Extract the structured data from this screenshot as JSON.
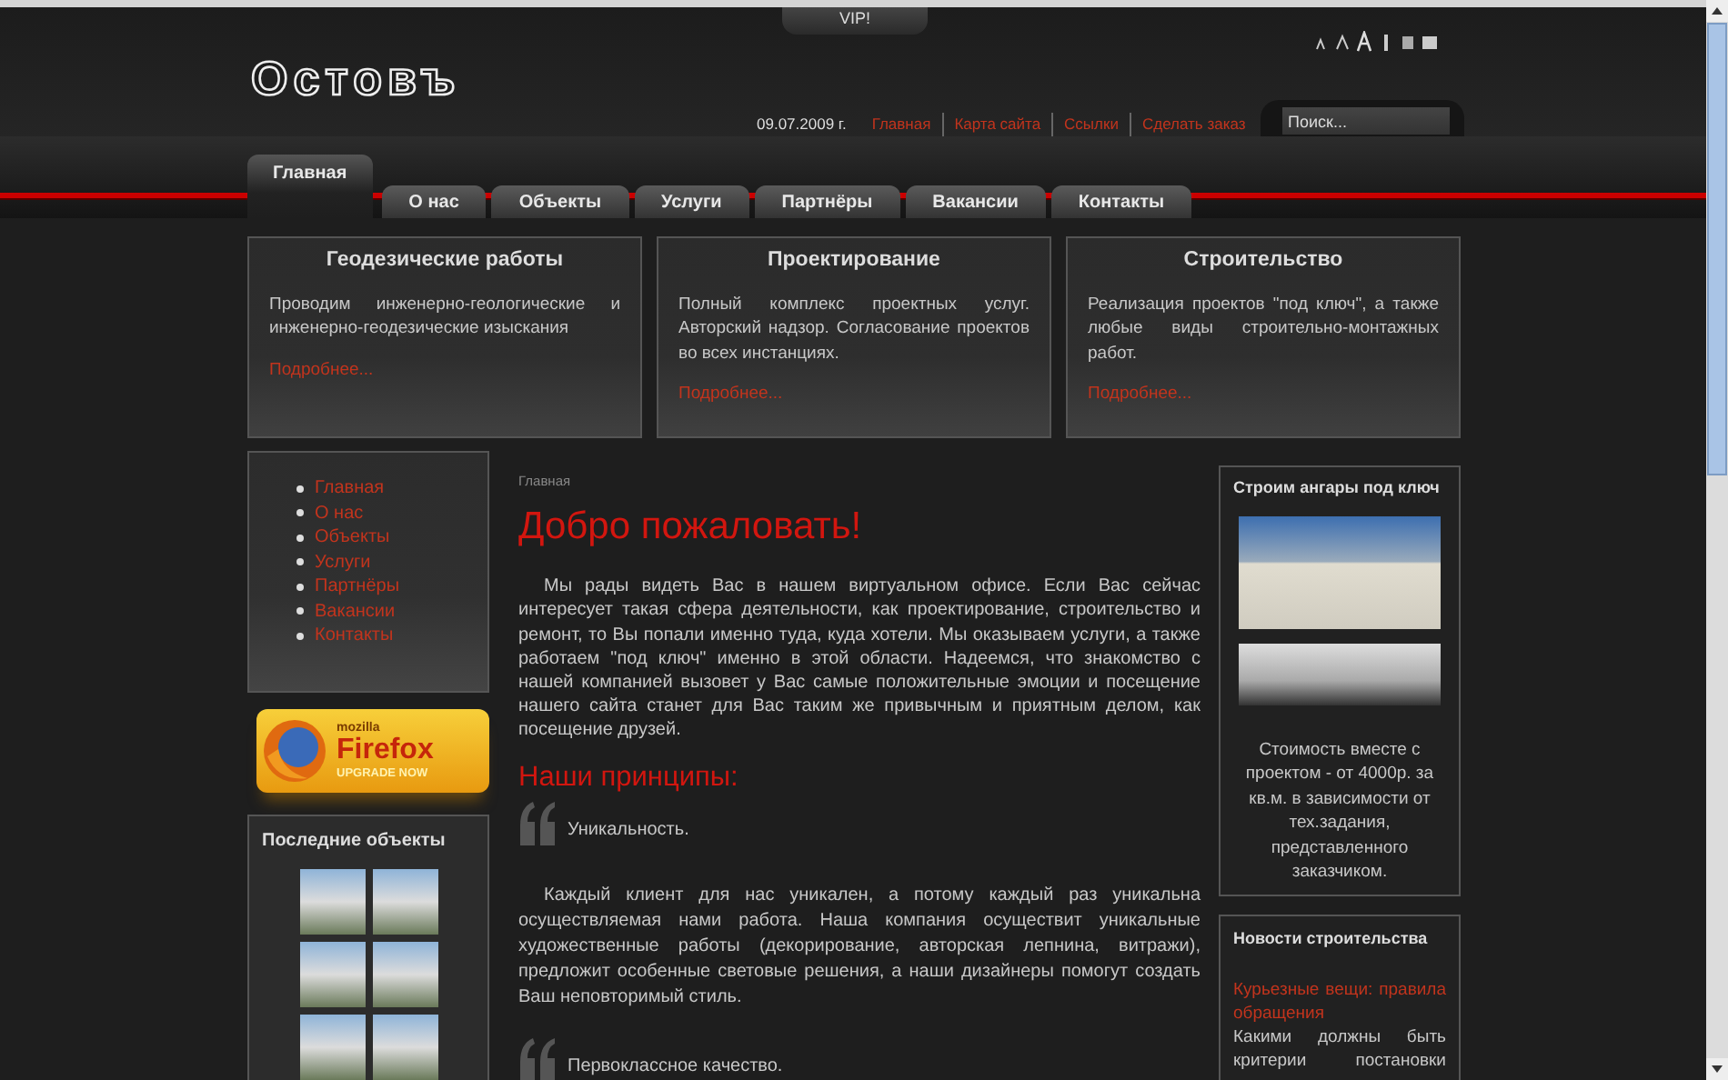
{
  "top_tab": "VIP!",
  "logo": "Остовъ",
  "date": "09.07.2009 г.",
  "top_links": [
    "Главная",
    "Карта сайта",
    "Ссылки",
    "Сделать заказ"
  ],
  "search": {
    "placeholder": "Поиск..."
  },
  "nav": [
    {
      "label": "Главная",
      "selected": true
    },
    {
      "label": "О нас",
      "selected": false
    },
    {
      "label": "Объекты",
      "selected": false
    },
    {
      "label": "Услуги",
      "selected": false
    },
    {
      "label": "Партнёры",
      "selected": false
    },
    {
      "label": "Вакансии",
      "selected": false
    },
    {
      "label": "Контакты",
      "selected": false
    }
  ],
  "services": [
    {
      "title": "Геодезические работы",
      "text": "Проводим инженерно-геологические и инженерно-геодезические изыскания",
      "link": "Подробнее..."
    },
    {
      "title": "Проектирование",
      "text": "Полный комплекс проектных услуг. Авторский надзор. Согласование проектов во всех инстанциях.",
      "link": "Подробнее..."
    },
    {
      "title": "Строительство",
      "text": "Реализация проектов \"под ключ\", а также любые виды строительно-монтажных работ.",
      "link": "Подробнее..."
    }
  ],
  "side_menu": [
    "Главная",
    "О нас",
    "Объекты",
    "Услуги",
    "Партнёры",
    "Вакансии",
    "Контакты"
  ],
  "firefox_banner": {
    "brand": "mozilla",
    "name": "Firefox",
    "tagline": "UPGRADE NOW"
  },
  "latest": {
    "title": "Последние объекты"
  },
  "breadcrumb": "Главная",
  "heading": "Добро пожаловать!",
  "intro": "Мы рады видеть Вас в нашем виртуальном офисе. Если Вас сейчас интересует такая сфера деятельности, как проектирование, строительство и ремонт, то Вы попали именно туда, куда хотели. Мы оказываем услуги, а также работаем \"под ключ\" именно в этой области. Надеемся, что знакомство с нашей компанией вызовет у Вас самые положительные эмоции и посещение нашего сайта станет для Вас таким же привычным и приятным делом, как посещение друзей.",
  "principles_heading": "Наши принципы:",
  "principles": [
    {
      "title": "Уникальность.",
      "text": "Каждый клиент для нас уникален, а потому каждый раз уникальна осуществляемая нами работа. Наша компания осуществит уникальные художественные работы (декорирование, авторская лепнина, витражи), предложит особенные световые решения, а наши дизайнеры помогут создать Ваш неповторимый стиль."
    },
    {
      "title": "Первоклассное качество."
    }
  ],
  "promo": {
    "title": "Строим ангары под ключ",
    "text": "Стоимость вместе с проектом - от 4000р. за кв.м. в зависимости от тех.задания, представленного заказчиком."
  },
  "news": {
    "title": "Новости строительства",
    "items": [
      {
        "link": "Курьезные вещи: правила обращения",
        "text": "Какими должны быть критерии постановки"
      }
    ]
  }
}
